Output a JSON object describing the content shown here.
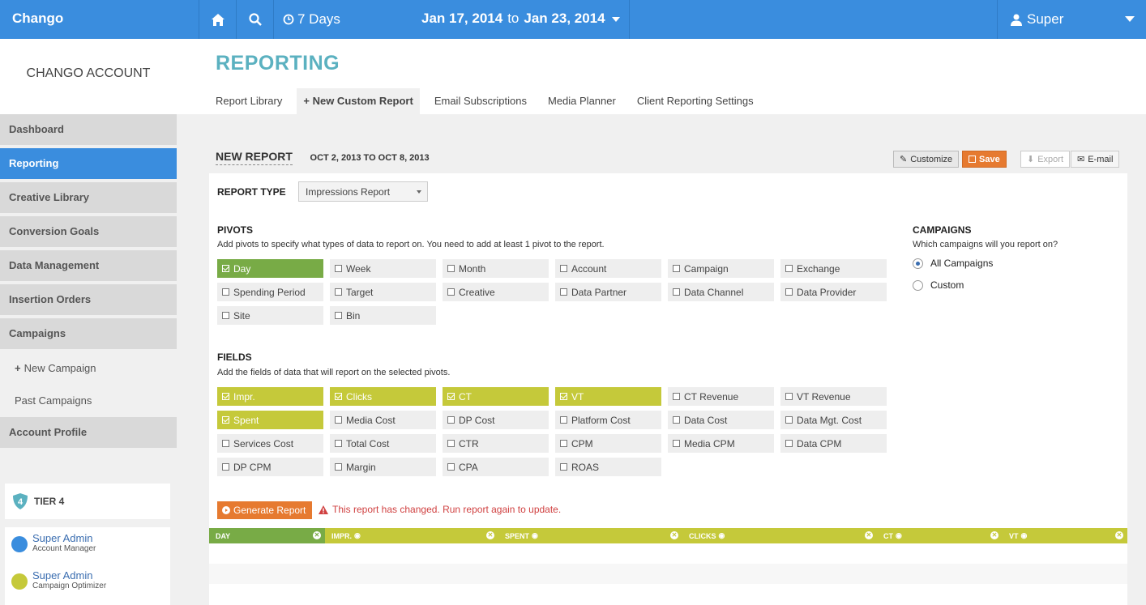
{
  "topbar": {
    "brand": "Chango",
    "range_label": "7 Days",
    "date_from": "Jan 17, 2014",
    "date_to_word": "to",
    "date_to": "Jan 23, 2014",
    "user": "Super"
  },
  "sidebar": {
    "account": "CHANGO ACCOUNT",
    "items": [
      {
        "label": "Dashboard"
      },
      {
        "label": "Reporting"
      },
      {
        "label": "Creative Library"
      },
      {
        "label": "Conversion Goals"
      },
      {
        "label": "Data Management"
      },
      {
        "label": "Insertion Orders"
      },
      {
        "label": "Campaigns"
      }
    ],
    "sub_items": [
      {
        "label": "New Campaign"
      },
      {
        "label": "Past Campaigns"
      }
    ],
    "account_profile": "Account Profile",
    "tier_badge": "4",
    "tier": "TIER 4",
    "people": [
      {
        "name": "Super Admin",
        "role": "Account Manager"
      },
      {
        "name": "Super Admin",
        "role": "Campaign Optimizer"
      }
    ]
  },
  "header": {
    "title": "REPORTING",
    "tabs": [
      {
        "label": "Report Library"
      },
      {
        "label": "New Custom Report"
      },
      {
        "label": "Email Subscriptions"
      },
      {
        "label": "Media Planner"
      },
      {
        "label": "Client Reporting Settings"
      }
    ]
  },
  "report": {
    "name": "NEW REPORT",
    "dates": "OCT 2, 2013 TO OCT 8, 2013",
    "customize": "Customize",
    "save": "Save",
    "export": "Export",
    "email": "E-mail",
    "type_label": "REPORT TYPE",
    "type_value": "Impressions Report",
    "pivots_label": "PIVOTS",
    "pivots_help": "Add pivots to specify what types of data to report on. You need to add at least 1 pivot to the report.",
    "pivots": [
      {
        "label": "Day",
        "checked": true
      },
      {
        "label": "Week",
        "checked": false
      },
      {
        "label": "Month",
        "checked": false
      },
      {
        "label": "Account",
        "checked": false
      },
      {
        "label": "Campaign",
        "checked": false
      },
      {
        "label": "Exchange",
        "checked": false
      },
      {
        "label": "Spending Period",
        "checked": false
      },
      {
        "label": "Target",
        "checked": false
      },
      {
        "label": "Creative",
        "checked": false
      },
      {
        "label": "Data Partner",
        "checked": false
      },
      {
        "label": "Data Channel",
        "checked": false
      },
      {
        "label": "Data Provider",
        "checked": false
      },
      {
        "label": "Site",
        "checked": false
      },
      {
        "label": "Bin",
        "checked": false
      }
    ],
    "fields_label": "FIELDS",
    "fields_help": "Add the fields of data that will report on the selected pivots.",
    "fields": [
      {
        "label": "Impr.",
        "checked": true
      },
      {
        "label": "Clicks",
        "checked": true
      },
      {
        "label": "CT",
        "checked": true
      },
      {
        "label": "VT",
        "checked": true
      },
      {
        "label": "CT Revenue",
        "checked": false
      },
      {
        "label": "VT Revenue",
        "checked": false
      },
      {
        "label": "Spent",
        "checked": true
      },
      {
        "label": "Media Cost",
        "checked": false
      },
      {
        "label": "DP Cost",
        "checked": false
      },
      {
        "label": "Platform Cost",
        "checked": false
      },
      {
        "label": "Data Cost",
        "checked": false
      },
      {
        "label": "Data Mgt. Cost",
        "checked": false
      },
      {
        "label": "Services Cost",
        "checked": false
      },
      {
        "label": "Total Cost",
        "checked": false
      },
      {
        "label": "CTR",
        "checked": false
      },
      {
        "label": "CPM",
        "checked": false
      },
      {
        "label": "Media CPM",
        "checked": false
      },
      {
        "label": "Data CPM",
        "checked": false
      },
      {
        "label": "DP CPM",
        "checked": false
      },
      {
        "label": "Margin",
        "checked": false
      },
      {
        "label": "CPA",
        "checked": false
      },
      {
        "label": "ROAS",
        "checked": false
      }
    ],
    "campaigns_label": "CAMPAIGNS",
    "campaigns_help": "Which campaigns will you report on?",
    "campaign_options": [
      {
        "label": "All Campaigns",
        "selected": true
      },
      {
        "label": "Custom",
        "selected": false
      }
    ],
    "generate": "Generate Report",
    "warning": "This report has changed. Run report again to update.",
    "columns": [
      "DAY",
      "IMPR.",
      "SPENT",
      "CLICKS",
      "CT",
      "VT"
    ]
  },
  "colors": {
    "brand_blue": "#3a8dde",
    "pivot_green": "#78ab46",
    "field_olive": "#c5c93a",
    "orange": "#e67a30",
    "warn_red": "#d04141",
    "title_teal": "#5bb1c0"
  }
}
